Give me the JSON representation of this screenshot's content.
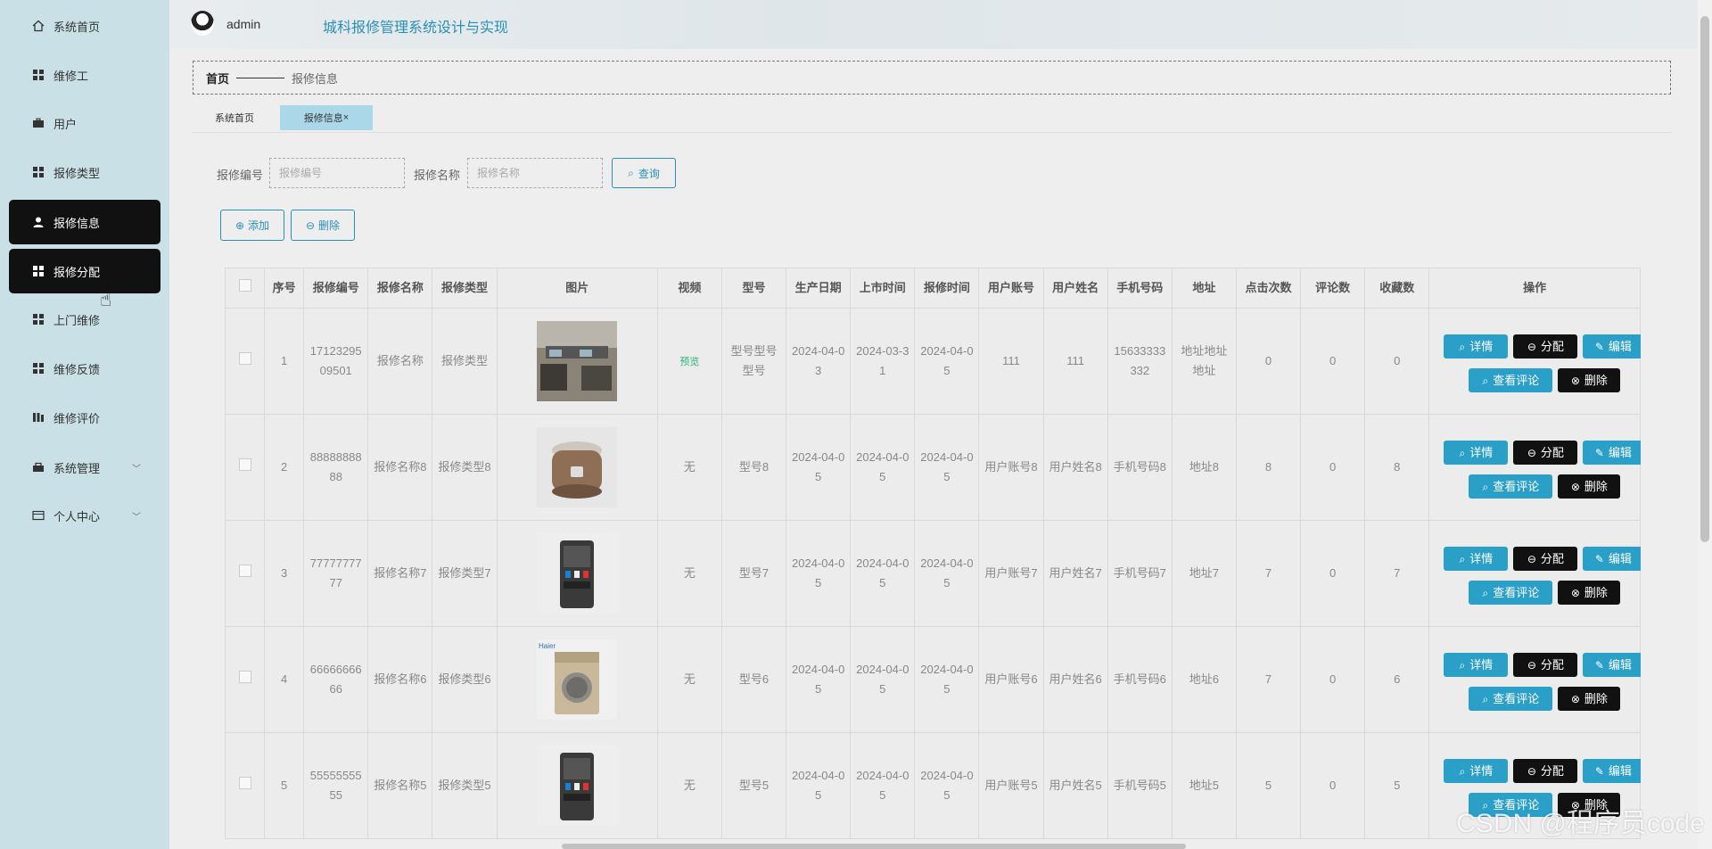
{
  "sidebar": {
    "items": [
      {
        "label": "系统首页",
        "icon": "home-icon"
      },
      {
        "label": "维修工",
        "icon": "grid-icon"
      },
      {
        "label": "用户",
        "icon": "briefcase-icon"
      },
      {
        "label": "报修类型",
        "icon": "grid-icon"
      },
      {
        "label": "报修信息",
        "icon": "user-icon"
      },
      {
        "label": "报修分配",
        "icon": "grid-icon"
      },
      {
        "label": "上门维修",
        "icon": "grid-icon"
      },
      {
        "label": "维修反馈",
        "icon": "grid-icon"
      },
      {
        "label": "维修评价",
        "icon": "bars-icon"
      },
      {
        "label": "系统管理",
        "icon": "toolbox-icon"
      },
      {
        "label": "个人中心",
        "icon": "card-icon"
      }
    ]
  },
  "header": {
    "username": "admin",
    "title": "城科报修管理系统设计与实现"
  },
  "breadcrumb": {
    "home": "首页",
    "current": "报修信息"
  },
  "tabs": {
    "first": "系统首页",
    "active": "报修信息"
  },
  "search": {
    "code_label": "报修编号",
    "code_placeholder": "报修编号",
    "name_label": "报修名称",
    "name_placeholder": "报修名称",
    "query_label": "查询"
  },
  "toolbar": {
    "add_label": "添加",
    "delete_label": "删除"
  },
  "table": {
    "headers": [
      "序号",
      "报修编号",
      "报修名称",
      "报修类型",
      "图片",
      "视频",
      "型号",
      "生产日期",
      "上市时间",
      "报修时间",
      "用户账号",
      "用户姓名",
      "手机号码",
      "地址",
      "点击次数",
      "评论数",
      "收藏数",
      "操作"
    ],
    "rows": [
      {
        "no": "1",
        "code": "1712329509501",
        "name": "报修名称",
        "type": "报修类型",
        "image": "office-photo",
        "video": "预览",
        "model": "型号型号型号",
        "prod": "2024-04-03",
        "market": "2024-03-31",
        "report": "2024-04-05",
        "account": "111",
        "uname": "111",
        "phone": "15633333332",
        "addr": "地址地址地址",
        "clicks": "0",
        "comments": "0",
        "favs": "0"
      },
      {
        "no": "2",
        "code": "8888888888",
        "name": "报修名称8",
        "type": "报修类型8",
        "image": "rice-cooker",
        "video": "无",
        "model": "型号8",
        "prod": "2024-04-05",
        "market": "2024-04-05",
        "report": "2024-04-05",
        "account": "用户账号8",
        "uname": "用户姓名8",
        "phone": "手机号码8",
        "addr": "地址8",
        "clicks": "8",
        "comments": "0",
        "favs": "8"
      },
      {
        "no": "3",
        "code": "7777777777",
        "name": "报修名称7",
        "type": "报修类型7",
        "image": "water-dispenser",
        "video": "无",
        "model": "型号7",
        "prod": "2024-04-05",
        "market": "2024-04-05",
        "report": "2024-04-05",
        "account": "用户账号7",
        "uname": "用户姓名7",
        "phone": "手机号码7",
        "addr": "地址7",
        "clicks": "7",
        "comments": "0",
        "favs": "7"
      },
      {
        "no": "4",
        "code": "6666666666",
        "name": "报修名称6",
        "type": "报修类型6",
        "image": "washing-machine",
        "video": "无",
        "model": "型号6",
        "prod": "2024-04-05",
        "market": "2024-04-05",
        "report": "2024-04-05",
        "account": "用户账号6",
        "uname": "用户姓名6",
        "phone": "手机号码6",
        "addr": "地址6",
        "clicks": "7",
        "comments": "0",
        "favs": "6"
      },
      {
        "no": "5",
        "code": "5555555555",
        "name": "报修名称5",
        "type": "报修类型5",
        "image": "water-dispenser",
        "video": "无",
        "model": "型号5",
        "prod": "2024-04-05",
        "market": "2024-04-05",
        "report": "2024-04-05",
        "account": "用户账号5",
        "uname": "用户姓名5",
        "phone": "手机号码5",
        "addr": "地址5",
        "clicks": "5",
        "comments": "0",
        "favs": "5"
      }
    ],
    "ops": {
      "detail": "详情",
      "assign": "分配",
      "edit": "编辑",
      "comments": "查看评论",
      "delete": "删除"
    }
  },
  "watermark": "CSDN @程序员code",
  "colors": {
    "accent": "#2a9fc8",
    "sidebar": "#c8e0e6",
    "active": "#111111"
  }
}
